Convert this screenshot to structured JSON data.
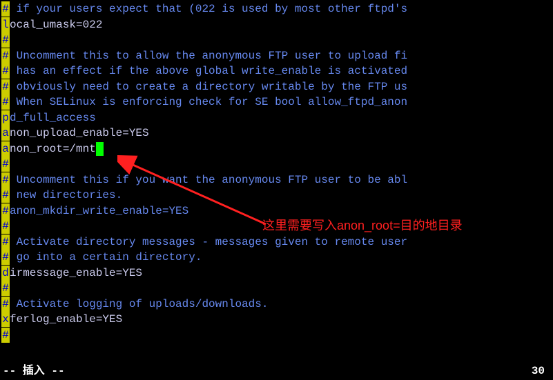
{
  "lines": [
    {
      "g": "#",
      "cls": "comment",
      "t": " if your users expect that (022 is used by most other ftpd's"
    },
    {
      "g": "l",
      "cls": "text",
      "t": "ocal_umask=022"
    },
    {
      "g": "#",
      "cls": "comment",
      "t": ""
    },
    {
      "g": "#",
      "cls": "comment",
      "t": " Uncomment this to allow the anonymous FTP user to upload fi"
    },
    {
      "g": "#",
      "cls": "comment",
      "t": " has an effect if the above global write_enable is activated"
    },
    {
      "g": "#",
      "cls": "comment",
      "t": " obviously need to create a directory writable by the FTP us"
    },
    {
      "g": "#",
      "cls": "comment",
      "t": " When SELinux is enforcing check for SE bool allow_ftpd_anon"
    },
    {
      "g": "p",
      "cls": "wrap",
      "t": "d_full_access"
    },
    {
      "g": "a",
      "cls": "text",
      "t": "non_upload_enable=YES"
    },
    {
      "g": "a",
      "cls": "text",
      "t": "non_root=/mnt",
      "cursor": true
    },
    {
      "g": "#",
      "cls": "comment",
      "t": ""
    },
    {
      "g": "#",
      "cls": "comment",
      "t": " Uncomment this if you want the anonymous FTP user to be abl"
    },
    {
      "g": "#",
      "cls": "comment",
      "t": " new directories."
    },
    {
      "g": "#",
      "cls": "comment",
      "t": "anon_mkdir_write_enable=YES"
    },
    {
      "g": "#",
      "cls": "comment",
      "t": ""
    },
    {
      "g": "#",
      "cls": "comment",
      "t": " Activate directory messages - messages given to remote user"
    },
    {
      "g": "#",
      "cls": "comment",
      "t": " go into a certain directory."
    },
    {
      "g": "d",
      "cls": "text",
      "t": "irmessage_enable=YES"
    },
    {
      "g": "#",
      "cls": "comment",
      "t": ""
    },
    {
      "g": "#",
      "cls": "comment",
      "t": " Activate logging of uploads/downloads."
    },
    {
      "g": "x",
      "cls": "text",
      "t": "ferlog_enable=YES"
    },
    {
      "g": "#",
      "cls": "comment",
      "t": ""
    }
  ],
  "status": {
    "mode": "-- 插入 --",
    "position": "30"
  },
  "annotation": "这里需要写入anon_root=目的地目录"
}
